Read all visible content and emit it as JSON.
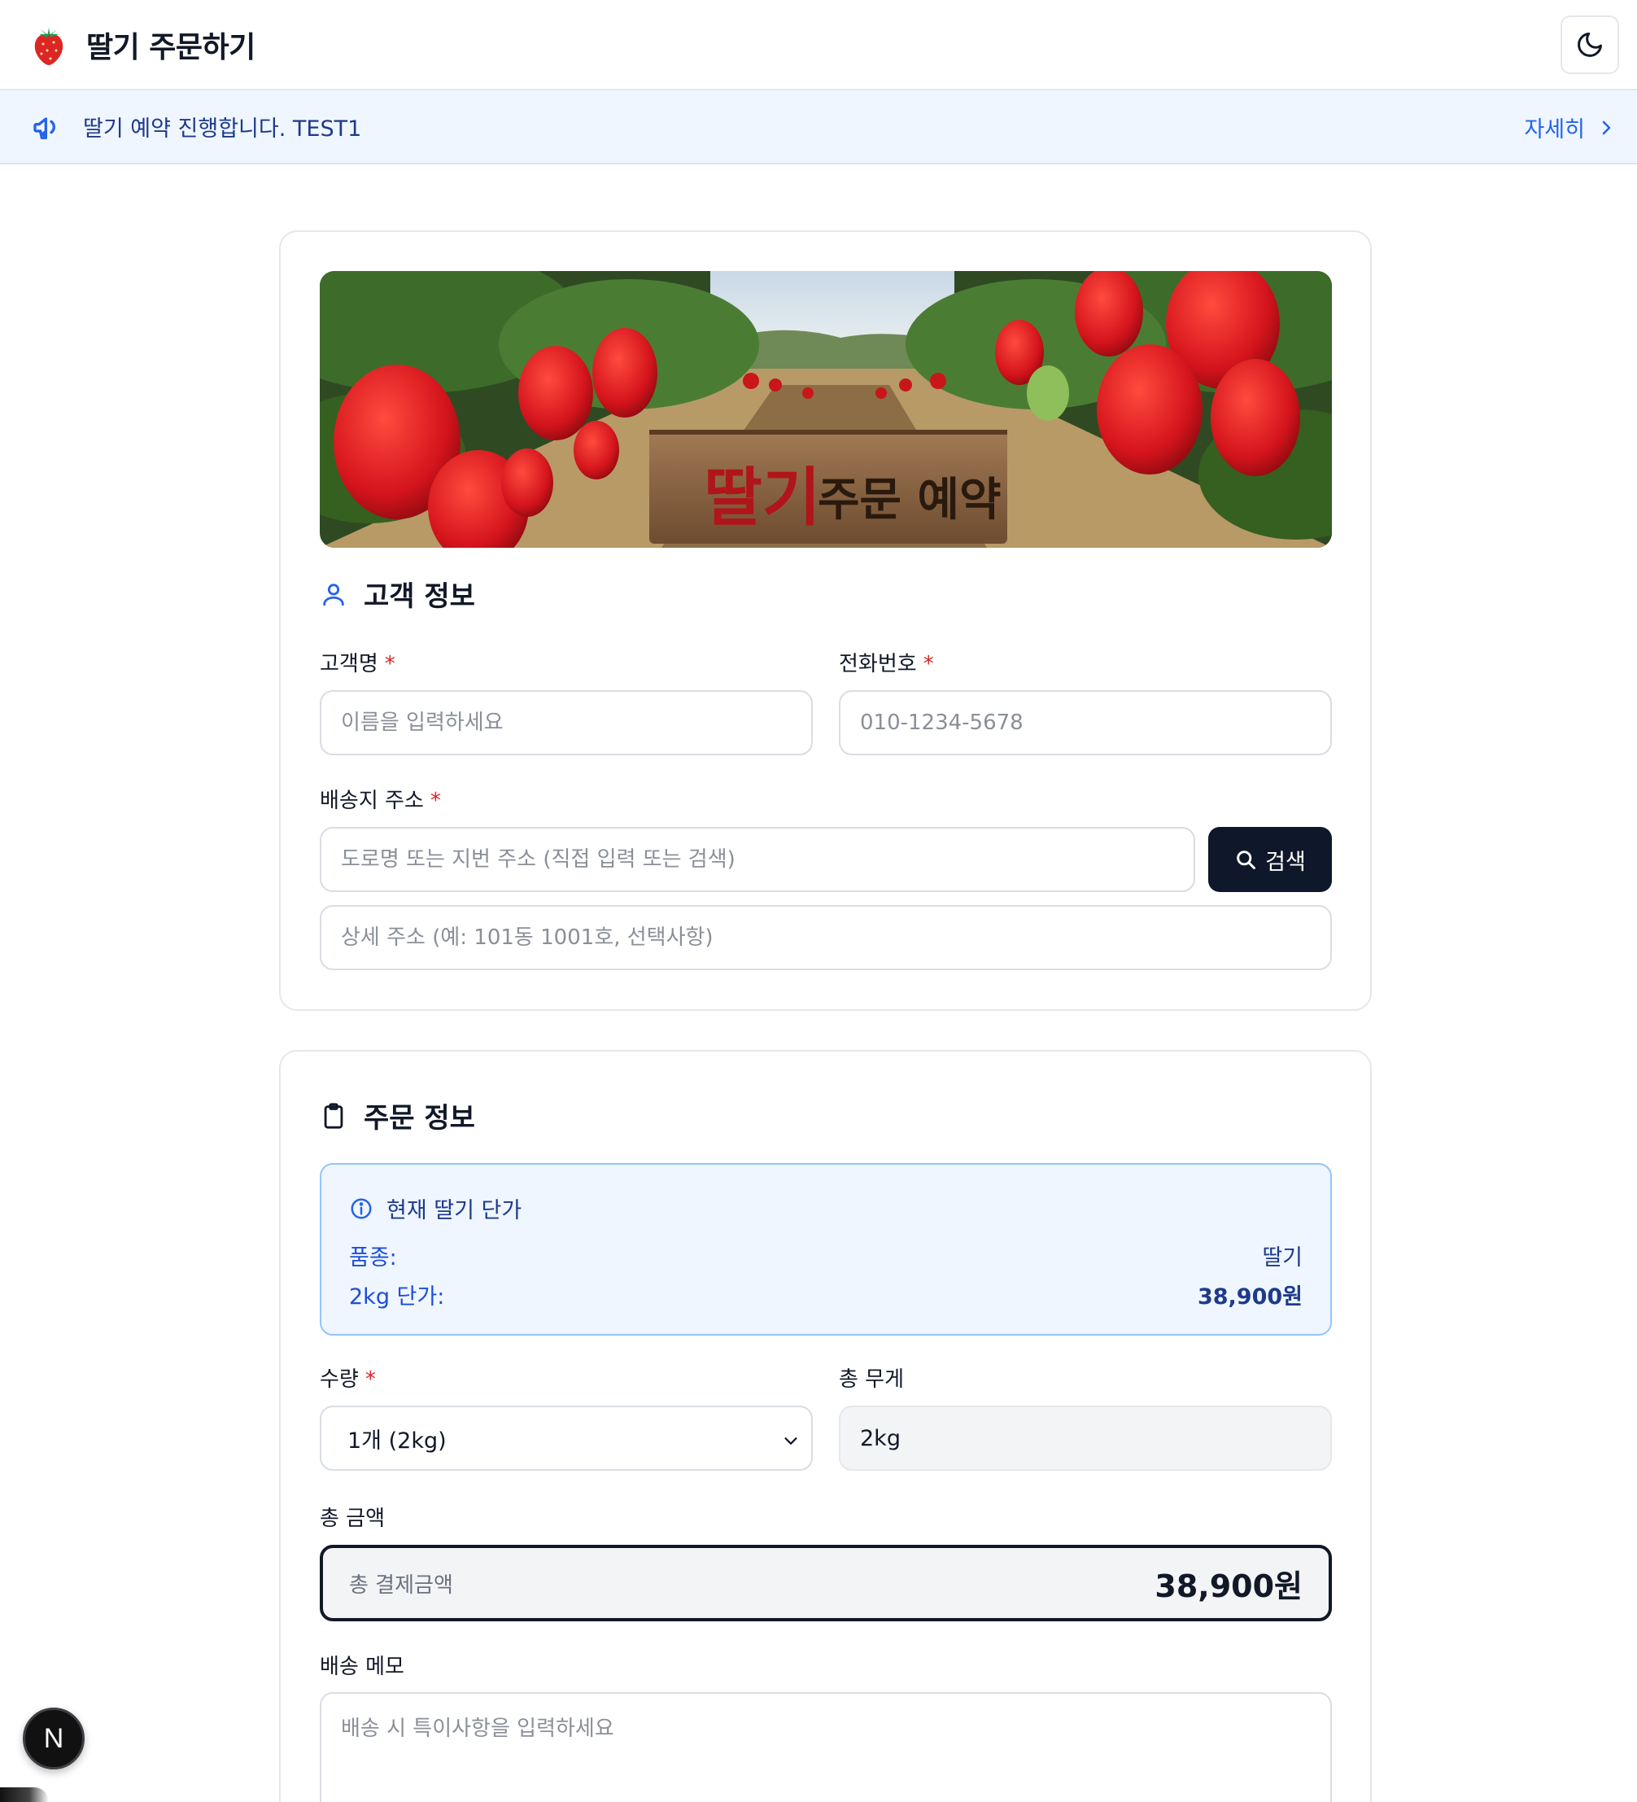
{
  "header": {
    "logo_icon": "strawberry-icon",
    "title": "딸기 주문하기",
    "theme_icon": "moon-icon"
  },
  "notice": {
    "icon": "megaphone-icon",
    "text": "딸기 예약 진행합니다. TEST1",
    "link_label": "자세히"
  },
  "banner": {
    "sign_strong": "딸기",
    "sign_rest": "주문 예약"
  },
  "customer": {
    "section_title": "고객 정보",
    "name_label": "고객명",
    "name_placeholder": "이름을 입력하세요",
    "phone_label": "전화번호",
    "phone_placeholder": "010-1234-5678",
    "address_label": "배송지 주소",
    "address_placeholder": "도로명 또는 지번 주소 (직접 입력 또는 검색)",
    "search_label": "검색",
    "detail_placeholder": "상세 주소 (예: 101동 1001호, 선택사항)",
    "required_mark": "*"
  },
  "order": {
    "section_title": "주문 정보",
    "price_box": {
      "title": "현재 딸기 단가",
      "variety_label": "품종:",
      "variety_value": "딸기",
      "unit_price_label": "2kg 단가:",
      "unit_price_value": "38,900원"
    },
    "quantity_label": "수량",
    "quantity_value": "1개 (2kg)",
    "weight_label": "총 무게",
    "weight_value": "2kg",
    "total_label": "총 금액",
    "total_inner_label": "총 결제금액",
    "total_value": "38,900원",
    "memo_label": "배송 메모",
    "memo_placeholder": "배송 시 특이사항을 입력하세요"
  },
  "dev_badge": {
    "letter": "N"
  },
  "colors": {
    "accent": "#2563eb",
    "notice_bg": "#eff6ff",
    "required": "#dc2626",
    "dark_button": "#0f172a"
  }
}
